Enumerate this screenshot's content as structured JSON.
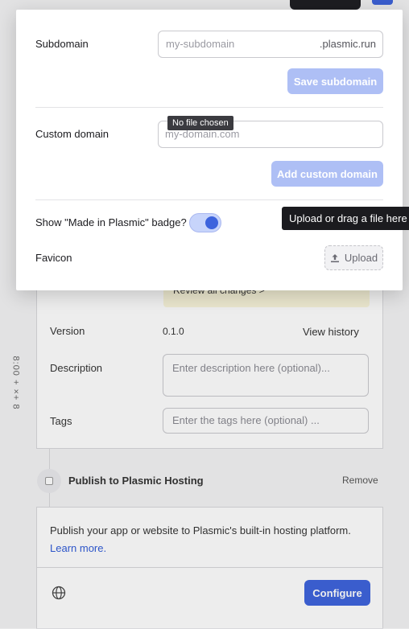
{
  "background": {
    "edge_text": "8:00 + ×+ 8",
    "review_changes_label": "Review all changes >",
    "version_label": "Version",
    "version_value": "0.1.0",
    "view_history_label": "View history",
    "description_label": "Description",
    "description_placeholder": "Enter description here (optional)...",
    "tags_label": "Tags",
    "tags_placeholder": "Enter the tags here (optional) ...",
    "publish_step_title": "Publish to Plasmic Hosting",
    "remove_label": "Remove",
    "hosting_description": "Publish your app or website to Plasmic's built-in hosting platform.",
    "learn_more_label": "Learn more.",
    "configure_label": "Configure"
  },
  "modal": {
    "subdomain_label": "Subdomain",
    "subdomain_placeholder": "my-subdomain",
    "subdomain_suffix": ".plasmic.run",
    "save_subdomain_label": "Save subdomain",
    "no_file_tooltip": "No file chosen",
    "custom_domain_label": "Custom domain",
    "custom_domain_placeholder": "my-domain.com",
    "add_custom_domain_label": "Add custom domain",
    "badge_label": "Show \"Made in Plasmic\" badge?",
    "badge_enabled": true,
    "upload_tooltip": "Upload or drag a file here",
    "favicon_label": "Favicon",
    "upload_label": "Upload"
  },
  "colors": {
    "accent": "#3d63dd",
    "accent_disabled": "#aebff5",
    "tooltip_bg": "#1b1b1f"
  }
}
